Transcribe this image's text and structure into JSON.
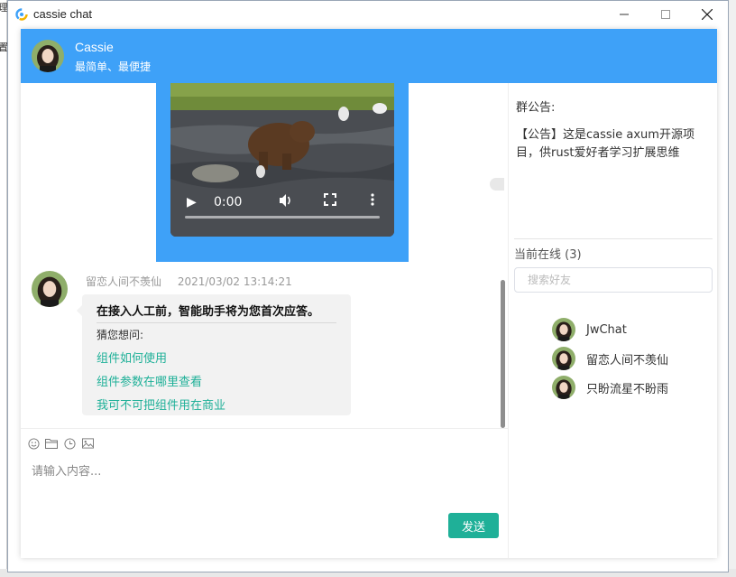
{
  "window": {
    "title": "cassie chat"
  },
  "left_strip": {
    "chars": [
      "理",
      "置"
    ]
  },
  "header": {
    "name": "Cassie",
    "subtitle": "最简单、最便捷"
  },
  "video": {
    "time": "0:00",
    "progress": 0
  },
  "message": {
    "sender": "留恋人间不羡仙",
    "time": "2021/03/02 13:14:21",
    "title": "在接入人工前，智能助手将为您首次应答。",
    "prompt": "猜您想问:",
    "links": [
      "组件如何使用",
      "组件参数在哪里查看",
      "我可不可把组件用在商业"
    ]
  },
  "input": {
    "placeholder": "请输入内容..."
  },
  "send_label": "发送",
  "notice": {
    "title": "群公告:",
    "text": "【公告】这是cassie axum开源项目，供rust爱好者学习扩展思维"
  },
  "online": {
    "title": "当前在线 (3)",
    "search_placeholder": "搜索好友",
    "users": [
      "JwChat",
      "留恋人间不羡仙",
      "只盼流星不盼雨"
    ]
  },
  "colors": {
    "accent": "#3ea1f8",
    "green": "#1fb098"
  }
}
